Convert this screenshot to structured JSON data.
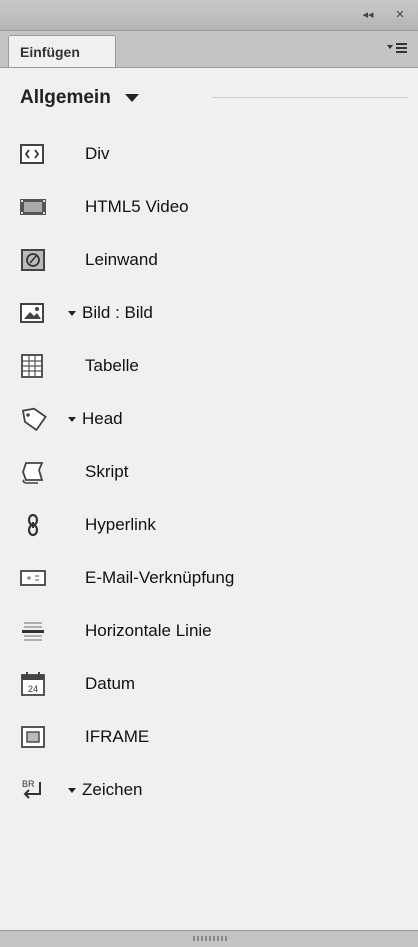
{
  "titlebar": {
    "collapse_glyph": "◂◂",
    "close_glyph": "✕"
  },
  "tab": {
    "label": "Einfügen"
  },
  "category": {
    "label": "Allgemein"
  },
  "items": [
    {
      "label": "Div",
      "icon": "div-icon"
    },
    {
      "label": "HTML5 Video",
      "icon": "video-icon"
    },
    {
      "label": "Leinwand",
      "icon": "canvas-icon"
    },
    {
      "label": "Bild : Bild",
      "icon": "image-icon",
      "dropdown": true
    },
    {
      "label": "Tabelle",
      "icon": "table-icon"
    },
    {
      "label": "Head",
      "icon": "tag-icon",
      "dropdown": true
    },
    {
      "label": "Skript",
      "icon": "script-icon"
    },
    {
      "label": "Hyperlink",
      "icon": "hyperlink-icon"
    },
    {
      "label": "E-Mail-Verknüpfung",
      "icon": "email-icon"
    },
    {
      "label": "Horizontale Linie",
      "icon": "horizontal-rule-icon"
    },
    {
      "label": "Datum",
      "icon": "date-icon"
    },
    {
      "label": "IFRAME",
      "icon": "iframe-icon"
    },
    {
      "label": "Zeichen",
      "icon": "character-icon",
      "dropdown": true
    }
  ]
}
